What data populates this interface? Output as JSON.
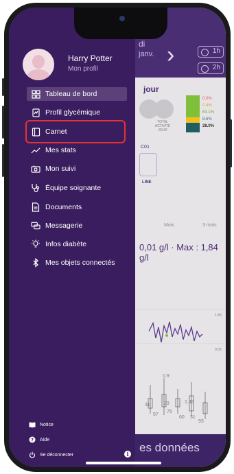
{
  "profile": {
    "name": "Harry Potter",
    "subtitle": "Mon profil"
  },
  "menu": [
    {
      "label": "Tableau de bord",
      "icon": "dashboard-icon",
      "active": true
    },
    {
      "label": "Profil glycémique",
      "icon": "glycemic-profile-icon"
    },
    {
      "label": "Carnet",
      "icon": "logbook-icon"
    },
    {
      "label": "Mes stats",
      "icon": "stats-icon"
    },
    {
      "label": "Mon suivi",
      "icon": "tracking-icon"
    },
    {
      "label": "Équipe soignante",
      "icon": "stethoscope-icon"
    },
    {
      "label": "Documents",
      "icon": "document-icon"
    },
    {
      "label": "Messagerie",
      "icon": "chat-icon"
    },
    {
      "label": "Infos diabète",
      "icon": "lightbulb-icon"
    },
    {
      "label": "Mes objets connectés",
      "icon": "bluetooth-icon"
    }
  ],
  "footer": [
    {
      "label": "Notice",
      "icon": "book-icon"
    },
    {
      "label": "Aide",
      "icon": "help-icon"
    },
    {
      "label": "Se déconnecter",
      "icon": "power-icon"
    }
  ],
  "background": {
    "day_title": "di",
    "day_subtitle": "janv.",
    "pill_1": "1h",
    "pill_2": "2h",
    "section_title": "jour",
    "total_label": "TOTAL\nACTIVITÉ\nJOUR",
    "percentages": [
      "0.0%",
      "0.4%",
      "63.1%",
      "8.6%",
      "28.0%"
    ],
    "code": "C01",
    "status": "LINE",
    "tabs": [
      "Mois",
      "3 mois"
    ],
    "glycemia_text": "0,01 g/l · Max : 1,84 g/l",
    "chart_labels": [
      "1.80",
      "0.05"
    ],
    "values": [
      "0.9",
      "31",
      "39",
      "1.49",
      "75",
      "57",
      "60",
      "31",
      "93"
    ],
    "bottom_text": "es données"
  },
  "colors": {
    "drawer": "#3a1d5e",
    "accent": "#c8a9d6",
    "highlight": "#e53232"
  }
}
